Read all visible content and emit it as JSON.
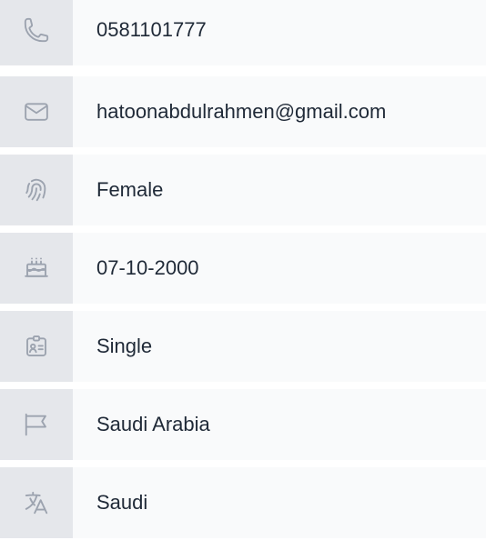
{
  "profile_details": {
    "phone": {
      "icon": "phone-icon",
      "value": "0581101777"
    },
    "email": {
      "icon": "envelope-icon",
      "value": "hatoonabdulrahmen@gmail.com"
    },
    "gender": {
      "icon": "fingerprint-icon",
      "value": "Female"
    },
    "birthdate": {
      "icon": "cake-icon",
      "value": "07-10-2000"
    },
    "marital_status": {
      "icon": "id-badge-icon",
      "value": "Single"
    },
    "country": {
      "icon": "flag-icon",
      "value": "Saudi Arabia"
    },
    "nationality": {
      "icon": "language-icon",
      "value": "Saudi"
    }
  },
  "colors": {
    "row_background": "#f9fafb",
    "icon_background": "#e5e7eb",
    "icon_stroke": "#9ca3af",
    "text": "#1f2937"
  }
}
